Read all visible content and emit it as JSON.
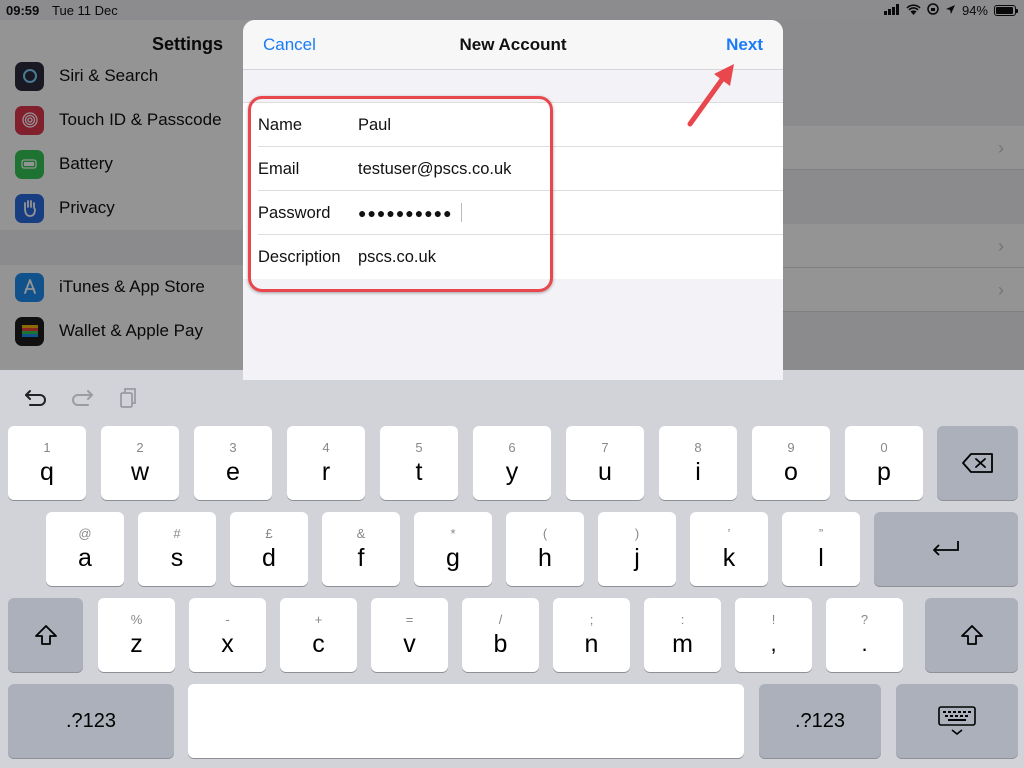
{
  "status_bar": {
    "time": "09:59",
    "date": "Tue 11 Dec",
    "battery": "94%",
    "battery_level": 0.94
  },
  "settings": {
    "title": "Settings",
    "items_top": [
      {
        "label": "Siri & Search",
        "icon": "siri-icon",
        "color": "#2b2b3d"
      },
      {
        "label": "Touch ID & Passcode",
        "icon": "fingerprint-icon",
        "color": "#e0364f"
      },
      {
        "label": "Battery",
        "icon": "battery-icon",
        "color": "#35c759"
      },
      {
        "label": "Privacy",
        "icon": "hand-icon",
        "color": "#2a6ce0"
      }
    ],
    "items_bottom": [
      {
        "label": "iTunes & App Store",
        "icon": "app-store-icon",
        "color": "#1f8ef1"
      },
      {
        "label": "Wallet & Apple Pay",
        "icon": "wallet-icon",
        "color": "#1c1c1e"
      }
    ]
  },
  "sheet": {
    "cancel": "Cancel",
    "title": "New Account",
    "next": "Next",
    "fields": [
      {
        "label": "Name",
        "value": "Paul"
      },
      {
        "label": "Email",
        "value": "testuser@pscs.co.uk"
      },
      {
        "label": "Password",
        "value": "●●●●●●●●●●"
      },
      {
        "label": "Description",
        "value": "pscs.co.uk"
      }
    ]
  },
  "keyboard": {
    "row1": [
      {
        "sub": "1",
        "main": "q"
      },
      {
        "sub": "2",
        "main": "w"
      },
      {
        "sub": "3",
        "main": "e"
      },
      {
        "sub": "4",
        "main": "r"
      },
      {
        "sub": "5",
        "main": "t"
      },
      {
        "sub": "6",
        "main": "y"
      },
      {
        "sub": "7",
        "main": "u"
      },
      {
        "sub": "8",
        "main": "i"
      },
      {
        "sub": "9",
        "main": "o"
      },
      {
        "sub": "0",
        "main": "p"
      }
    ],
    "row2": [
      {
        "sub": "@",
        "main": "a"
      },
      {
        "sub": "#",
        "main": "s"
      },
      {
        "sub": "£",
        "main": "d"
      },
      {
        "sub": "&",
        "main": "f"
      },
      {
        "sub": "*",
        "main": "g"
      },
      {
        "sub": "(",
        "main": "h"
      },
      {
        "sub": ")",
        "main": "j"
      },
      {
        "sub": "’",
        "main": "k"
      },
      {
        "sub": "”",
        "main": "l"
      }
    ],
    "row3": [
      {
        "sub": "%",
        "main": "z"
      },
      {
        "sub": "-",
        "main": "x"
      },
      {
        "sub": "+",
        "main": "c"
      },
      {
        "sub": "=",
        "main": "v"
      },
      {
        "sub": "/",
        "main": "b"
      },
      {
        "sub": ";",
        "main": "n"
      },
      {
        "sub": ":",
        "main": "m"
      },
      {
        "sub": "!",
        "main": ","
      },
      {
        "sub": "?",
        "main": "."
      }
    ],
    "numbers_label": ".?123"
  }
}
